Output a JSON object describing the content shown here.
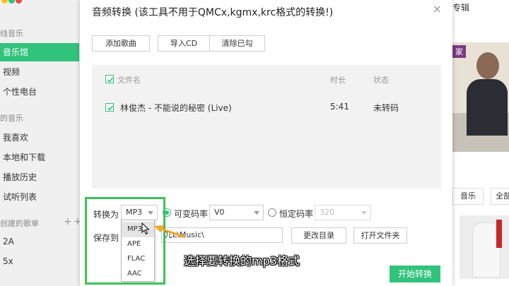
{
  "app": {
    "sidebar": {
      "section_online": "线音乐",
      "items_top": [
        "音乐馆",
        "视频",
        "个性电台"
      ],
      "section_mine": "的音乐",
      "items_mine": [
        "我喜欢",
        "本地和下载",
        "播放历史",
        "试听列表"
      ],
      "section_created": "创建的歌单",
      "playlists": [
        "2A",
        "5x"
      ],
      "add_symbol": "+"
    },
    "right_panel": {
      "tab_label": "专辑",
      "banner_tag": "家",
      "button_a": "音乐",
      "button_b": "全部"
    }
  },
  "dialog": {
    "title": "音频转换 (该工具不用于QMCx,kgmx,krc格式的转换!)",
    "close_symbol": "×",
    "toolbar": {
      "add_song": "添加歌曲",
      "import_cd": "导入CD",
      "clear_checked": "清除已勾"
    },
    "list": {
      "columns": {
        "filename": "文件名",
        "duration": "时长",
        "status": "状态"
      },
      "rows": [
        {
          "checked": true,
          "filename": "林俊杰 - 不能说的秘密 (Live)",
          "duration": "5:41",
          "status": "未转码"
        }
      ]
    },
    "convert_to_label": "转换为",
    "format_selected": "MP3",
    "format_options": [
      "MP3",
      "APE",
      "FLAC",
      "AAC"
    ],
    "vbr_label": "可变码率",
    "vbr_value": "V0",
    "cbr_label": "恒定码率",
    "cbr_value": "320",
    "save_to_label": "保存到",
    "save_path": "兀L\\Music\\",
    "change_dir": "更改目录",
    "open_folder": "打开文件夹",
    "start": "开始转换"
  },
  "overlay": {
    "caption": "选择要转换的mp3格式"
  },
  "colors": {
    "accent": "#31c27c",
    "highlight": "#3ec25a",
    "arrow": "#f5a623"
  }
}
